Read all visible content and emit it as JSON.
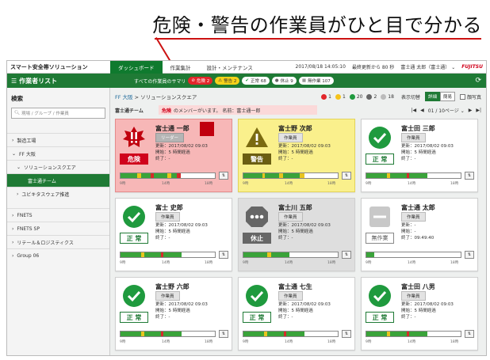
{
  "headline": "危険・警告の作業員がひと目で分かる",
  "header": {
    "app_title": "スマート安全帯ソリューション",
    "tabs": [
      "ダッシュボード",
      "作業集計",
      "設計・メンテナンス"
    ],
    "datetime": "2017/08/18 14:05:10",
    "last_update": "最終更新から 80 秒",
    "user": "富士通 太郎（富士通）",
    "brand": "FUJITSU"
  },
  "subheader": {
    "title": "作業者リスト",
    "summary_label": "すべての作業員のサマリ",
    "pills": [
      {
        "label": "危険 2",
        "kind": "danger"
      },
      {
        "label": "警告 2",
        "kind": "warn"
      },
      {
        "label": "正常 68",
        "kind": "ok"
      },
      {
        "label": "休止 9",
        "kind": "rest"
      },
      {
        "label": "無作業 107",
        "kind": "off"
      }
    ]
  },
  "sidebar": {
    "heading": "検索",
    "search_placeholder": "現場 / グループ / 作業員",
    "items": [
      {
        "label": "製造工場",
        "level": 0,
        "arrow": "›"
      },
      {
        "label": "FF 大阪",
        "level": 0,
        "arrow": "⌄"
      },
      {
        "label": "ソリューションスクエア",
        "level": 1,
        "arrow": "⌄"
      },
      {
        "label": "富士通チーム",
        "level": 2,
        "arrow": "",
        "active": true
      },
      {
        "label": "ユビキタスウェア推進",
        "level": 1,
        "arrow": "›"
      },
      {
        "label": "FNETS",
        "level": 0,
        "arrow": "›"
      },
      {
        "label": "FNETS SP",
        "level": 0,
        "arrow": "›"
      },
      {
        "label": "リテール＆ロジスティクス",
        "level": 0,
        "arrow": "›"
      },
      {
        "label": "Group 06",
        "level": 0,
        "arrow": "›"
      }
    ]
  },
  "main": {
    "breadcrumb_site": "FF 大阪",
    "breadcrumb_sep": ">",
    "breadcrumb_group": "ソリューションスクエア",
    "counts": [
      {
        "value": "1",
        "color": "#e2262a"
      },
      {
        "value": "1",
        "color": "#f5c31a"
      },
      {
        "value": "20",
        "color": "#1f9a3e"
      },
      {
        "value": "2",
        "color": "#666666"
      },
      {
        "value": "18",
        "color": "#bbbbbb"
      }
    ],
    "view_label": "表示切替",
    "view_options": [
      "詳細",
      "簡易"
    ],
    "photo_label": "顔写真",
    "team_name": "富士通チーム",
    "alert_label": "危険",
    "alert_text": "のメンバーがいます。 名前：富士通一郎",
    "pager": {
      "first": "|◀",
      "prev": "◀",
      "page": "01 / 10ページ",
      "next": "▶",
      "last": "▶|"
    }
  },
  "timeline_labels": [
    "9時",
    "14時",
    "18時"
  ],
  "info_labels": {
    "update": "更新：",
    "start": "開始：",
    "end": "終了："
  },
  "workers": [
    {
      "name": "富士通 一郎",
      "role": "リーダー",
      "status": "danger",
      "status_label": "危険",
      "icon": "danger-icon",
      "update": "2017/08/02 09:03",
      "start": "5 時間経過",
      "end": "-",
      "marker": true
    },
    {
      "name": "富士野 次郎",
      "role": "作業員",
      "status": "warn",
      "status_label": "警告",
      "icon": "warning-icon",
      "update": "2017/08/02 09:03",
      "start": "5 時間経過",
      "end": "-"
    },
    {
      "name": "富士田 三郎",
      "role": "作業員",
      "status": "ok",
      "status_label": "正 常",
      "icon": "check-icon",
      "update": "2017/08/02 09:03",
      "start": "5 時間経過",
      "end": "-"
    },
    {
      "name": "富士 史郎",
      "role": "作業員",
      "status": "ok",
      "status_label": "正 常",
      "icon": "check-icon",
      "update": "2017/08/02 09:03",
      "start": "5 時間経過",
      "end": "-"
    },
    {
      "name": "富士川 五郎",
      "role": "作業員",
      "status": "rest",
      "status_label": "休止",
      "icon": "pause-icon",
      "update": "2017/08/02 09:03",
      "start": "5 時間経過",
      "end": "-"
    },
    {
      "name": "富士通 太郎",
      "role": "作業員",
      "status": "off",
      "status_label": "無作業",
      "icon": "minus-icon",
      "update": "-",
      "start": "-",
      "end": "09:49:40"
    },
    {
      "name": "富士野 六郎",
      "role": "作業員",
      "status": "ok",
      "status_label": "正 常",
      "icon": "check-icon",
      "update": "2017/08/02 09:03",
      "start": "5 時間経過",
      "end": "-"
    },
    {
      "name": "富士通 七生",
      "role": "作業員",
      "status": "ok",
      "status_label": "正 常",
      "icon": "check-icon",
      "update": "2017/08/02 09:03",
      "start": "5 時間経過",
      "end": "-"
    },
    {
      "name": "富士田 八男",
      "role": "作業員",
      "status": "ok",
      "status_label": "正 常",
      "icon": "check-icon",
      "update": "2017/08/02 09:03",
      "start": "5 時間経過",
      "end": "-"
    }
  ],
  "colors": {
    "green": "#1f7a35",
    "danger": "#d0021b",
    "warn": "#f5d21a",
    "timeline_ok": "#3aa33a",
    "timeline_warn": "#e8c51e",
    "timeline_danger": "#d62a2a"
  }
}
